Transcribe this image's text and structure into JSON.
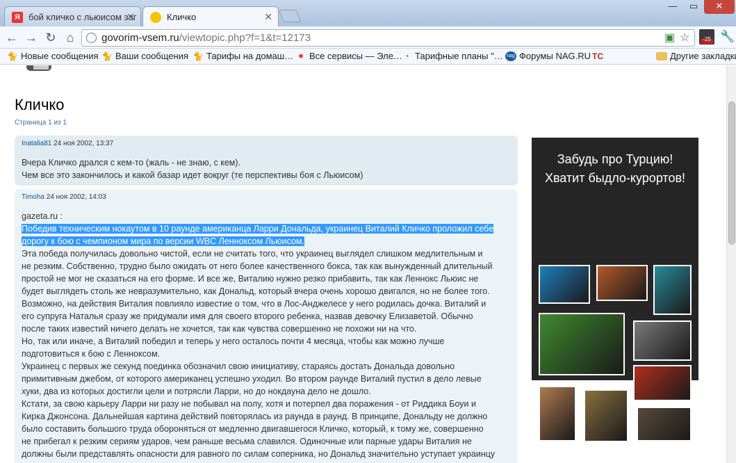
{
  "tabs": [
    {
      "label": "бой кличко с льюисом заг"
    },
    {
      "label": "Кличко"
    }
  ],
  "window_controls": {
    "minimize": "—",
    "maximize": "▭",
    "close": "✕"
  },
  "address": {
    "domain": "govorim-vsem.ru",
    "path": "/viewtopic.php?f=1&t=12173"
  },
  "extension_badge": "-25",
  "bookmarks": [
    {
      "label": "Новые сообщения",
      "icon": "cat-icon"
    },
    {
      "label": "Ваши сообщения",
      "icon": "cat-icon"
    },
    {
      "label": "Тарифы на домаш…",
      "icon": "cat-icon"
    },
    {
      "label": "Все сервисы — Эле…",
      "icon": "star-icon"
    },
    {
      "label": "Тарифные планы \"…",
      "icon": "phone-icon"
    },
    {
      "label": "Форумы NAG.RU",
      "icon": "nag-icon"
    },
    {
      "label": "",
      "icon": "tc-icon"
    },
    {
      "label": "Другие закладки",
      "icon": "folder-icon"
    }
  ],
  "page": {
    "title": "Кличко",
    "pagination": "Страница 1 из 1"
  },
  "posts": [
    {
      "author": "Inatalia81",
      "date": "24 ноя 2002, 13:37",
      "lines": [
        "Вчера Кличко дрался с кем-то (жаль - не знаю, с кем).",
        "Чем все это закончилось и какой базар идет вокруг (те перспективы боя с Льюисом)"
      ]
    },
    {
      "author": "Timoha",
      "date": "24 ноя 2002, 14:03",
      "source": "gazeta.ru :",
      "highlight_1": "Победив техническим нокаутом в 10 раунде американца Ларри Дональда, украинец Виталий Кличко проложил себе",
      "highlight_2": "дорогу к бою с чемпионом мира по версии WBC Ленноксом Льюисом.",
      "lines": [
        "Эта победа получилась довольно чистой, если не считать того, что украинец выглядел слишком медлительным и",
        "не резким. Собственно, трудно было ожидать от него более качественного бокса, так как вынужденный длительный",
        "простой не мог не сказаться на его форме. И все же, Виталию нужно резко прибавить, так как Леннокс Льюис не",
        "будет выглядеть столь же невразумительно, как Дональд, который вчера очень хорошо двигался, но не более того.",
        "Возможно, на действия Виталия повлияло известие о том, что в Лос-Анджелесе у него родилась дочка. Виталий и",
        "его супруга Наталья сразу же придумали имя для своего второго ребенка, назвав девочку Елизаветой. Обычно",
        "после таких известий ничего делать не хочется, так как чувства совершенно не похожи ни на что.",
        "Но, так или иначе, а Виталий победил и теперь у него осталось почти 4 месяца, чтобы как можно лучше",
        "подготовиться к бою с Ленноксом.",
        "Украинец с первых же секунд поединка обозначил свою инициативу, стараясь достать Дональда довольно",
        "примитивным джебом, от которого американец успешно уходил. Во втором раунде Виталий пустил в дело левые",
        "хуки, два из которых достигли цели и потрясли Ларри, но до нокдауна дело не дошло.",
        "Кстати, за свою карьеру Ларри ни разу не побывал на полу, хотя и потерпел два поражения - от Риддика Боуи и",
        "Кирка Джонсона. Дальнейшая картина действий повторялась из раунда в раунд. В принципе, Дональду не должно",
        "было составить большого труда обороняться от медленно двигавшегося Кличко, который, к тому же, совершенно",
        "не прибегал к резким сериям ударов, чем раньше весьма славился. Одиночные или парные удары Виталия не",
        "должны были представлять опасности для равного по силам соперника, но Дональд значительно уступает украинцу"
      ]
    }
  ],
  "ad": {
    "line1": "Забудь про Турцию!",
    "line2": "Хватит быдло-курортов!",
    "photos": [
      {
        "name": "atoll-photo",
        "color": "#1f7fbf"
      },
      {
        "name": "sunset-photo",
        "color": "#b25a2a"
      },
      {
        "name": "coast-aerial-photo",
        "color": "#2a8a9a"
      },
      {
        "name": "heart-forest-photo",
        "color": "#3f8a2f"
      },
      {
        "name": "anchors-photo",
        "color": "#7a7a7a"
      },
      {
        "name": "red-car-photo",
        "color": "#b2301f"
      },
      {
        "name": "petra-photo",
        "color": "#b07a50"
      },
      {
        "name": "sphere-sculpture-photo",
        "color": "#8a7040"
      },
      {
        "name": "fish-photo",
        "color": "#5a4a3a"
      }
    ]
  }
}
